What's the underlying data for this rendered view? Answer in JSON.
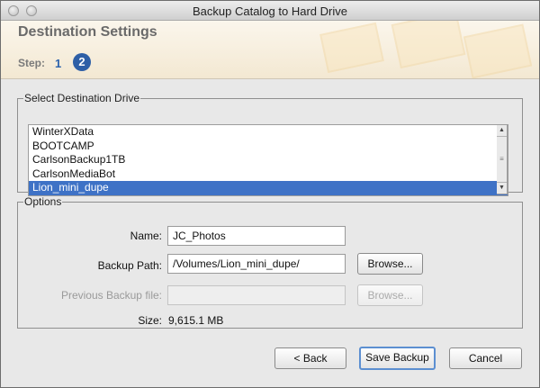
{
  "window": {
    "title": "Backup Catalog to Hard Drive"
  },
  "header": {
    "title": "Destination Settings",
    "step_label": "Step:",
    "steps": [
      "1",
      "2"
    ],
    "current_step": 2
  },
  "destination": {
    "legend": "Select Destination Drive",
    "drives": [
      "WinterXData",
      "BOOTCAMP",
      "CarlsonBackup1TB",
      "CarlsonMediaBot",
      "Lion_mini_dupe"
    ],
    "selected_index": 4
  },
  "options": {
    "legend": "Options",
    "name_label": "Name:",
    "name_value": "JC_Photos",
    "backup_path_label": "Backup Path:",
    "backup_path_value": "/Volumes/Lion_mini_dupe/",
    "browse_label": "Browse...",
    "previous_backup_label": "Previous Backup file:",
    "previous_backup_value": "",
    "previous_browse_label": "Browse...",
    "size_label": "Size:",
    "size_value": "9,615.1 MB"
  },
  "buttons": {
    "back": "< Back",
    "save": "Save Backup",
    "cancel": "Cancel"
  },
  "colors": {
    "accent": "#2e5fa6",
    "selection": "#3e72c6"
  }
}
